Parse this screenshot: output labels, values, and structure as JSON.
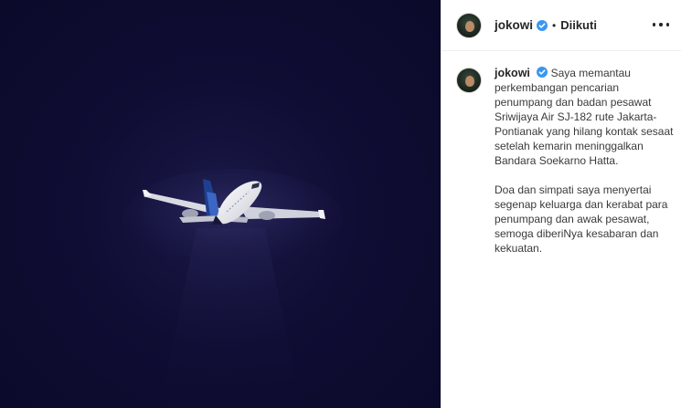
{
  "post": {
    "author": {
      "username": "jokowi",
      "verified": true,
      "verified_icon": "verified-badge-icon",
      "separator": "•",
      "follow_status": "Diikuti"
    },
    "more_icon": "more-options-icon",
    "caption": {
      "username": "jokowi",
      "paragraph_1": "Saya memantau perkembangan pencarian penumpang dan badan pesawat Sriwijaya Air SJ-182 rute Jakarta-Pontianak yang hilang kontak sesaat setelah kemarin meninggalkan Bandara Soekarno Hatta.",
      "paragraph_2": "Doa dan simpati saya menyertai segenap keluarga dan kerabat para penumpang dan awak pesawat, semoga diberiNya kesabaran dan kekuatan."
    },
    "media": {
      "description_icon": "airplane-illustration",
      "background_color": "#0f0d33",
      "accent_color": "#3897f0"
    }
  }
}
